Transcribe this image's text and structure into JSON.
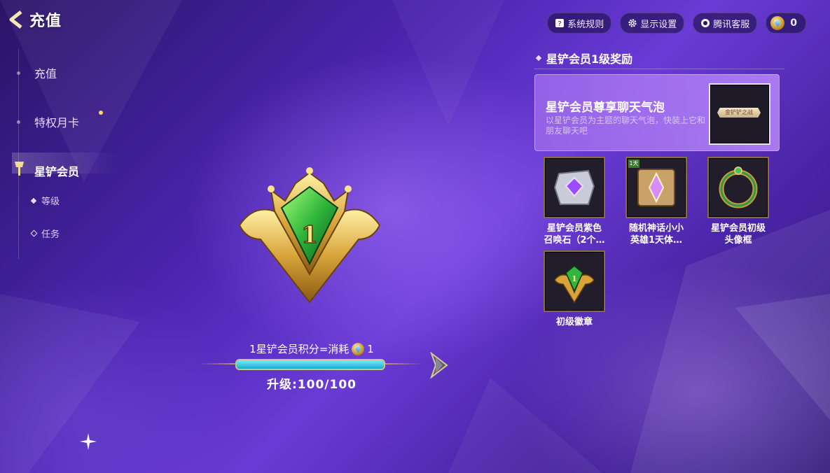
{
  "header": {
    "back_title": "充值"
  },
  "topbar": {
    "rules_label": "系统规则",
    "display_label": "显示设置",
    "support_label": "腾讯客服",
    "currency_amount": "0"
  },
  "nav": {
    "items": [
      {
        "label": "充值"
      },
      {
        "label": "特权月卡"
      },
      {
        "label": "星铲会员"
      },
      {
        "label": "等级"
      },
      {
        "label": "任务"
      }
    ]
  },
  "center": {
    "emblem_level": "1",
    "points_text": "1星铲会员积分=消耗",
    "points_cost": "1",
    "upgrade_text": "升级:100/100",
    "progress": 1.0
  },
  "rewards_panel": {
    "title": "星铲会员1级奖励",
    "feature": {
      "title": "星铲会员尊享聊天气泡",
      "desc": "以星铲会员为主题的聊天气泡，快装上它和朋友聊天吧",
      "preview_text": "金铲铲之战"
    },
    "items": [
      {
        "name": "星铲会员紫色召唤石（2个…",
        "icon": "purple-summon-stone-icon"
      },
      {
        "name": "随机神话小小英雄1天体…",
        "icon": "mythic-box-icon",
        "badge": "1天"
      },
      {
        "name": "星铲会员初级头像框",
        "icon": "avatar-frame-icon"
      },
      {
        "name": "初级徽章",
        "icon": "badge-icon"
      }
    ]
  },
  "colors": {
    "accent_gold": "#d8a850",
    "progress": "#1aa9cc",
    "panel": "#9664e6"
  }
}
